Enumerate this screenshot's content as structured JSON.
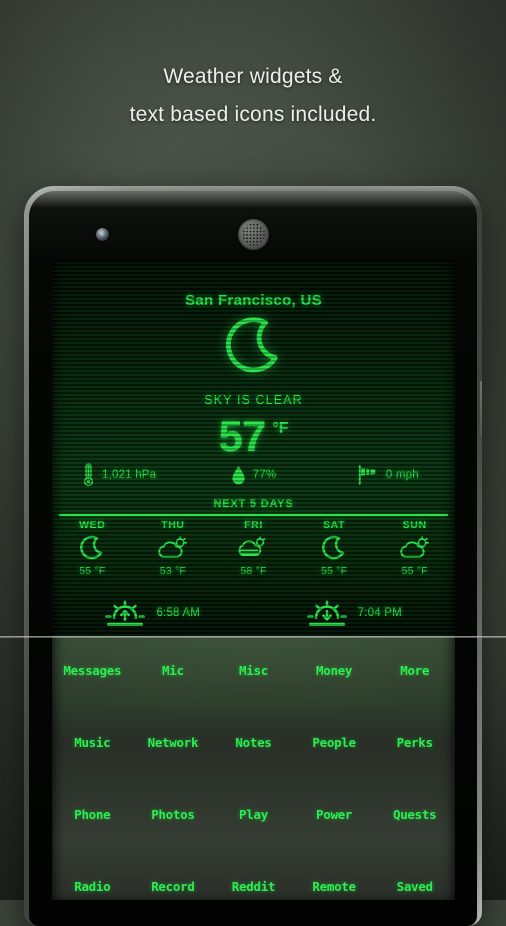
{
  "headline": {
    "line1": "Weather widgets &",
    "line2": "text based icons included."
  },
  "colors": {
    "accent_green": "#2bed4f",
    "screen_dark": "#020a03",
    "background": "#3c443a",
    "headline_text": "#eceee9"
  },
  "phone": {
    "camera": "front-camera",
    "speaker": "earpiece-speaker"
  },
  "weather": {
    "city": "San Francisco, US",
    "condition_icon": "moon-crescent-icon",
    "condition": "SKY IS CLEAR",
    "temperature": "57",
    "temperature_unit": "°F",
    "metrics": [
      {
        "icon": "thermometer-icon",
        "value": "1,021 hPa"
      },
      {
        "icon": "water-drop-icon",
        "value": "77%"
      },
      {
        "icon": "windsock-icon",
        "value": "0 mph"
      }
    ],
    "forecast_header": "NEXT 5 DAYS",
    "forecast": [
      {
        "day": "WED",
        "icon": "moon-crescent-icon",
        "temp": "55 °F"
      },
      {
        "day": "THU",
        "icon": "cloud-sun-icon",
        "temp": "53 °F"
      },
      {
        "day": "FRI",
        "icon": "mist-cloud-icon",
        "temp": "58 °F"
      },
      {
        "day": "SAT",
        "icon": "moon-crescent-icon",
        "temp": "55 °F"
      },
      {
        "day": "SUN",
        "icon": "cloud-sun-icon",
        "temp": "55 °F"
      }
    ],
    "sunrise": {
      "icon": "sunrise-icon",
      "time": "6:58 AM"
    },
    "sunset": {
      "icon": "sunset-icon",
      "time": "7:04 PM"
    }
  },
  "drawer": {
    "rows": [
      [
        "Messages",
        "Mic",
        "Misc",
        "Money",
        "More"
      ],
      [
        "Music",
        "Network",
        "Notes",
        "People",
        "Perks"
      ],
      [
        "Phone",
        "Photos",
        "Play",
        "Power",
        "Quests"
      ],
      [
        "Radio",
        "Record",
        "Reddit",
        "Remote",
        "Saved"
      ]
    ]
  }
}
